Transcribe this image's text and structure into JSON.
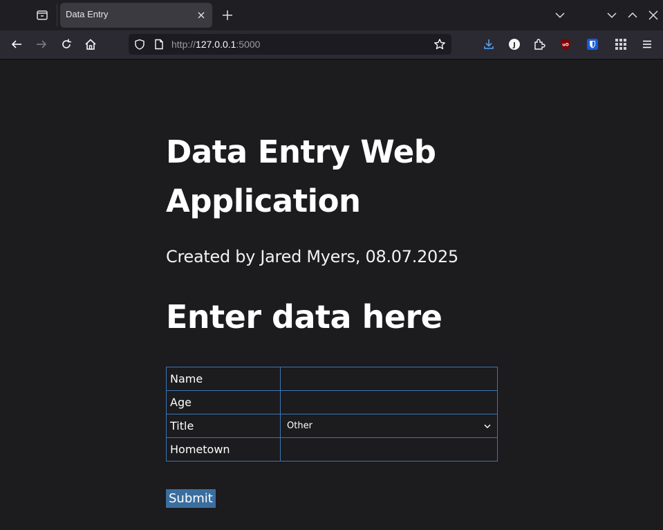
{
  "browser": {
    "tab": {
      "title": "Data Entry"
    },
    "address": {
      "scheme": "http://",
      "host": "127.0.0.1",
      "port": ":5000"
    }
  },
  "page": {
    "heading": "Data Entry Web Application",
    "subtitle": "Created by Jared Myers, 08.07.2025",
    "form_heading": "Enter data here",
    "fields": [
      {
        "label": "Name",
        "value": ""
      },
      {
        "label": "Age",
        "value": ""
      },
      {
        "label": "Title",
        "selected": "Other"
      },
      {
        "label": "Hometown",
        "value": ""
      }
    ],
    "submit_label": "Submit"
  },
  "colors": {
    "accent": "#3a6e9e",
    "table_border": "#3a78b5",
    "page_background": "#1c1b1e"
  },
  "icons": [
    "tab-overview-icon",
    "close-icon",
    "plus-icon",
    "chevron-down-icon",
    "minimize-icon",
    "maximize-icon",
    "back-icon",
    "forward-icon",
    "reload-icon",
    "home-icon",
    "shield-icon",
    "page-icon",
    "star-icon",
    "download-icon",
    "extension-j-icon",
    "extensions-icon",
    "ublock-icon",
    "bitwarden-icon",
    "apps-grid-icon",
    "menu-icon"
  ]
}
